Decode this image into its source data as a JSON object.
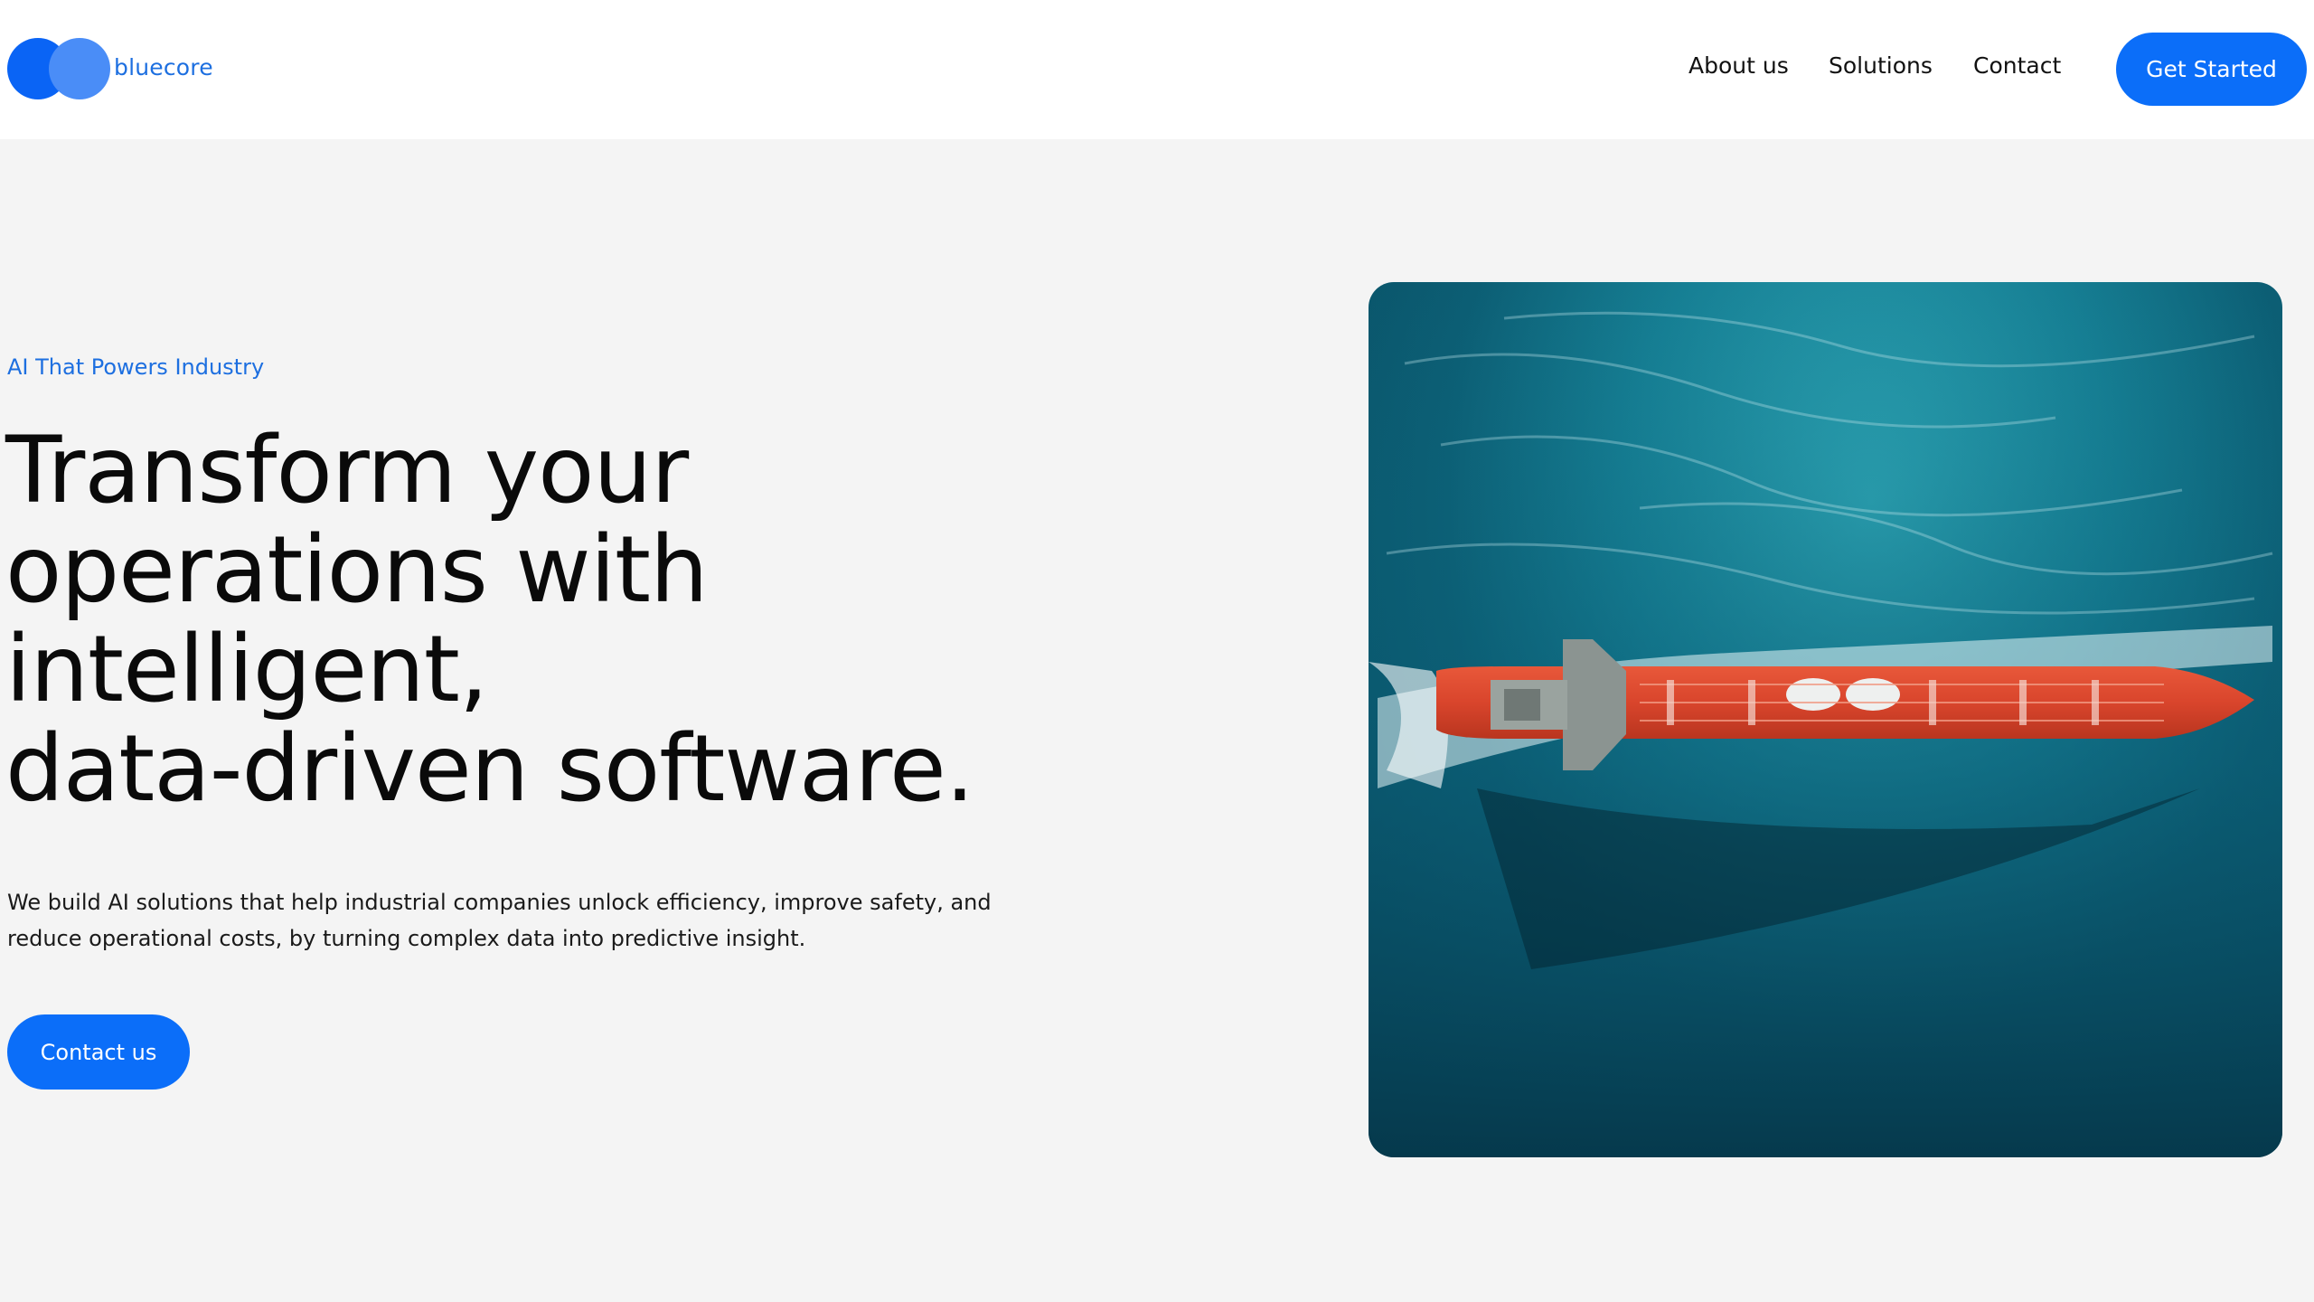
{
  "header": {
    "brand": "bluecore",
    "nav": [
      "About us",
      "Solutions",
      "Contact"
    ],
    "cta_label": "Get Started"
  },
  "hero": {
    "eyebrow": "AI That Powers Industry",
    "headline_lines": [
      "Transform your",
      "operations with",
      "intelligent,",
      "data-driven software."
    ],
    "subtext": "We build AI solutions that help industrial companies unlock efficiency, improve safety, and reduce operational costs, by turning complex data into predictive insight.",
    "contact_label": "Contact us",
    "image_subject": "aerial-view-of-red-tanker-ship-on-turquoise-sea"
  },
  "colors": {
    "accent": "#0b6ef9",
    "brand_text": "#1d6fe0",
    "background": "#f4f4f4",
    "header_bg": "#ffffff"
  }
}
